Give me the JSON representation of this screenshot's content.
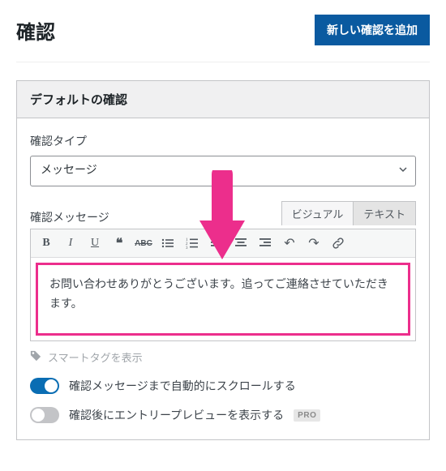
{
  "header": {
    "title": "確認",
    "add_button": "新しい確認を追加"
  },
  "panel": {
    "title": "デフォルトの確認",
    "type_label": "確認タイプ",
    "type_value": "メッセージ",
    "message_label": "確認メッセージ",
    "tabs": {
      "visual": "ビジュアル",
      "text": "テキスト"
    },
    "toolbar": {
      "bold": "B",
      "italic": "I",
      "underline": "U",
      "quote": "❝",
      "strike": "ABC",
      "ul": "≣",
      "ol": "≣",
      "align_left": "≡",
      "align_center": "≡",
      "align_right": "≡",
      "undo": "↶",
      "redo": "↷",
      "link": "🔗"
    },
    "message_body": "お問い合わせありがとうございます。追ってご連絡させていただきます。",
    "smart_tags": "スマートタグを表示",
    "toggle_scroll": "確認メッセージまで自動的にスクロールする",
    "toggle_preview": "確認後にエントリープレビューを表示する",
    "pro": "PRO"
  }
}
